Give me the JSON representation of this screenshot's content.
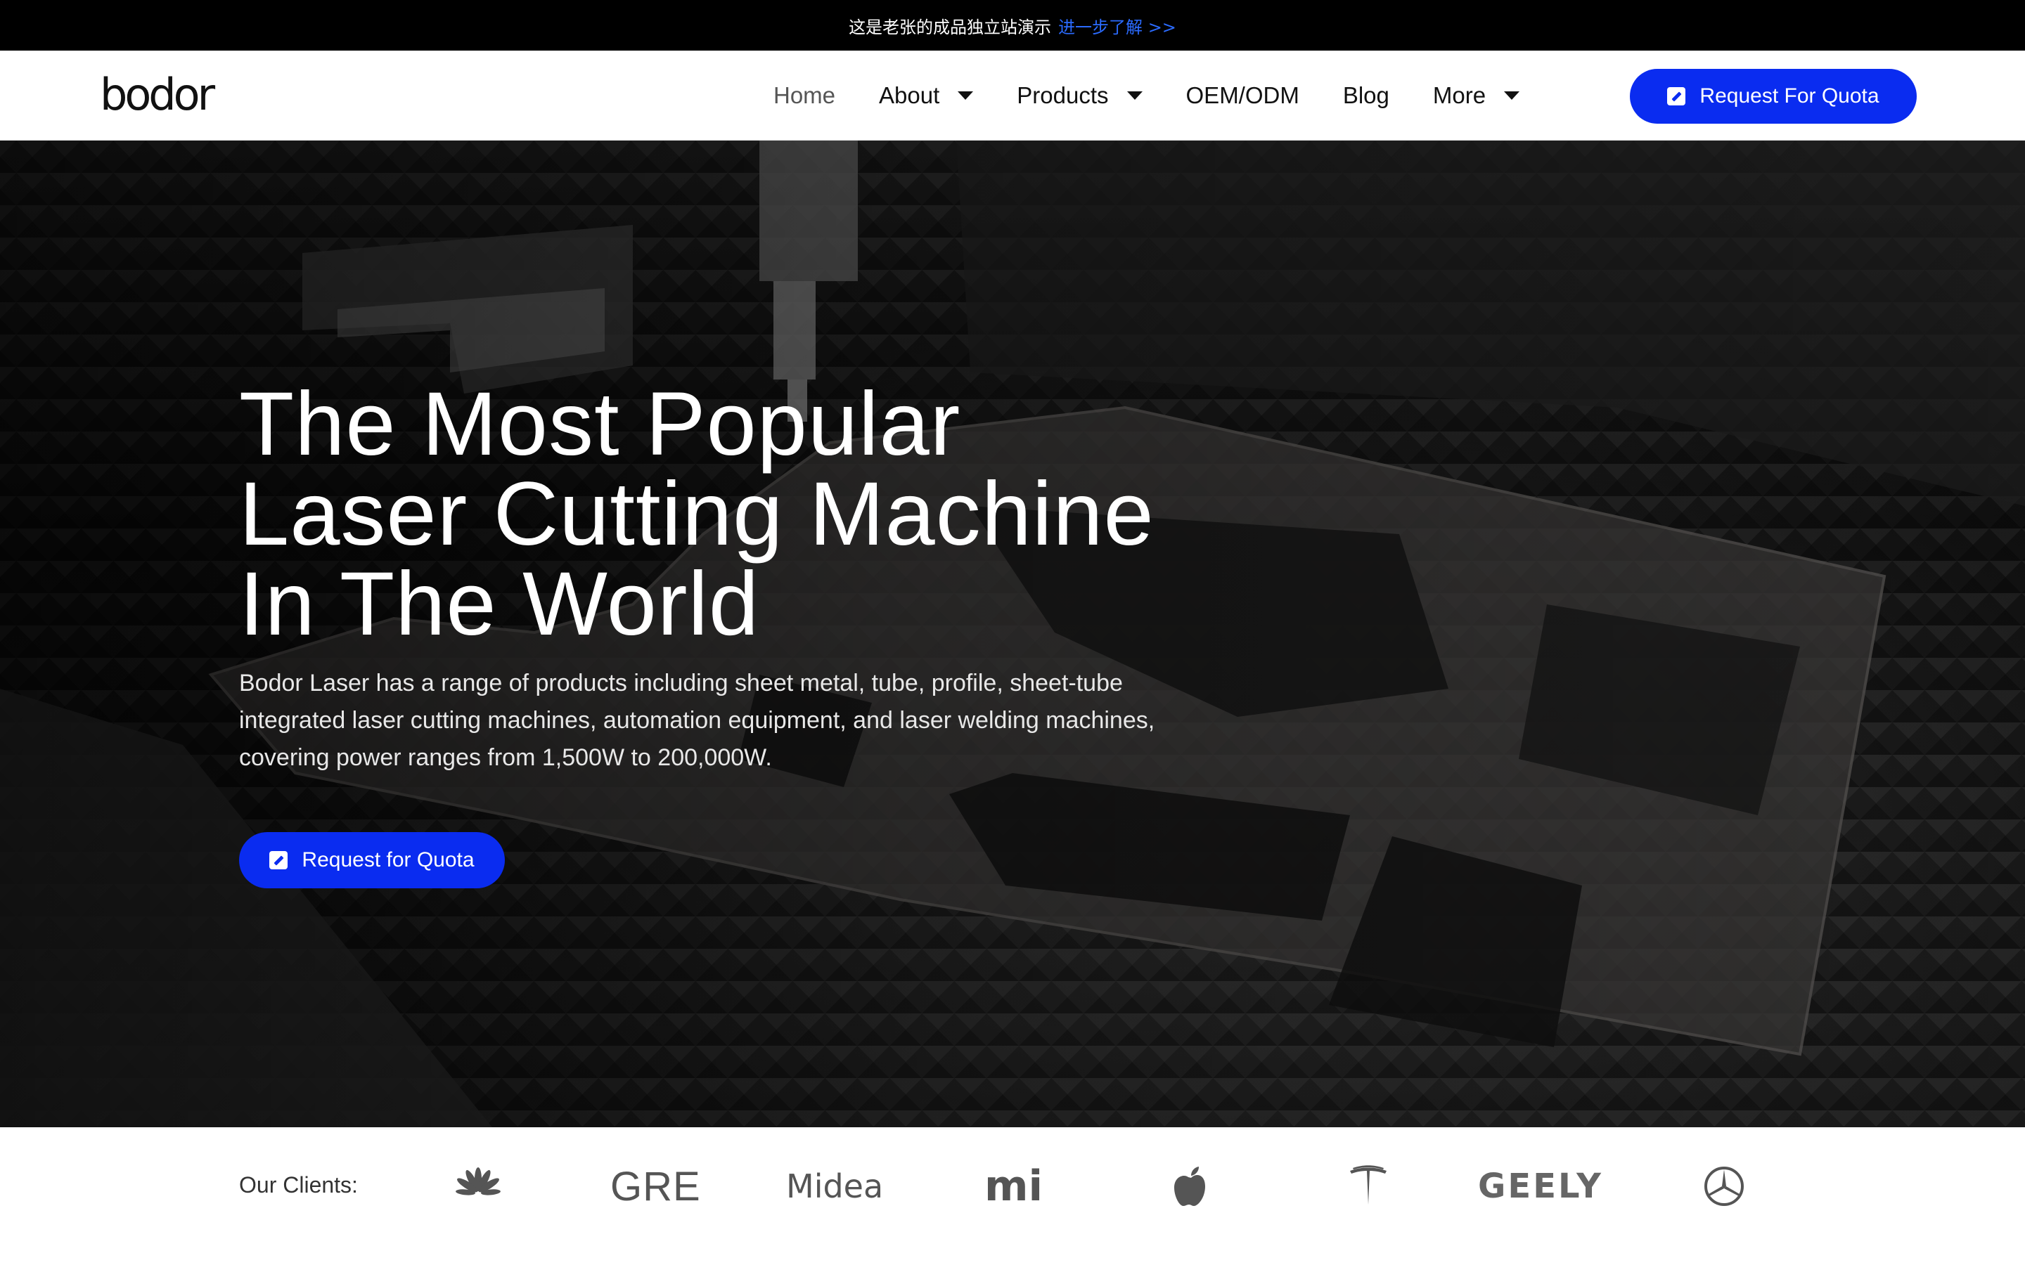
{
  "topbar": {
    "text": "这是老张的成品独立站演示",
    "link": "进一步了解 >>"
  },
  "header": {
    "logo_text": "bodor",
    "nav": [
      {
        "label": "Home",
        "active": true,
        "dropdown": false
      },
      {
        "label": "About",
        "active": false,
        "dropdown": true
      },
      {
        "label": "Products",
        "active": false,
        "dropdown": true
      },
      {
        "label": "OEM/ODM",
        "active": false,
        "dropdown": false
      },
      {
        "label": "Blog",
        "active": false,
        "dropdown": false
      },
      {
        "label": "More",
        "active": false,
        "dropdown": true
      }
    ],
    "cta_label": "Request For Quota"
  },
  "hero": {
    "title_lines": [
      "The Most Popular",
      "Laser Cutting Machine",
      "In The World"
    ],
    "description": "Bodor Laser has a range of products including sheet metal, tube, profile, sheet-tube integrated laser cutting machines, automation equipment, and laser welding machines, covering power ranges from 1,500W to 200,000W.",
    "cta_label": "Request for Quota"
  },
  "clients": {
    "label": "Our Clients:",
    "logos": [
      {
        "name": "huawei-logo"
      },
      {
        "name": "gre-logo",
        "text": "GRE"
      },
      {
        "name": "midea-logo",
        "text": "Midea"
      },
      {
        "name": "mi-logo",
        "text": "mi"
      },
      {
        "name": "apple-logo"
      },
      {
        "name": "tesla-logo"
      },
      {
        "name": "geely-logo",
        "text": "GEELY"
      },
      {
        "name": "mercedes-logo"
      }
    ]
  },
  "colors": {
    "accent": "#0a2cf0",
    "link": "#2b6bff",
    "topbar_bg": "#000000"
  }
}
